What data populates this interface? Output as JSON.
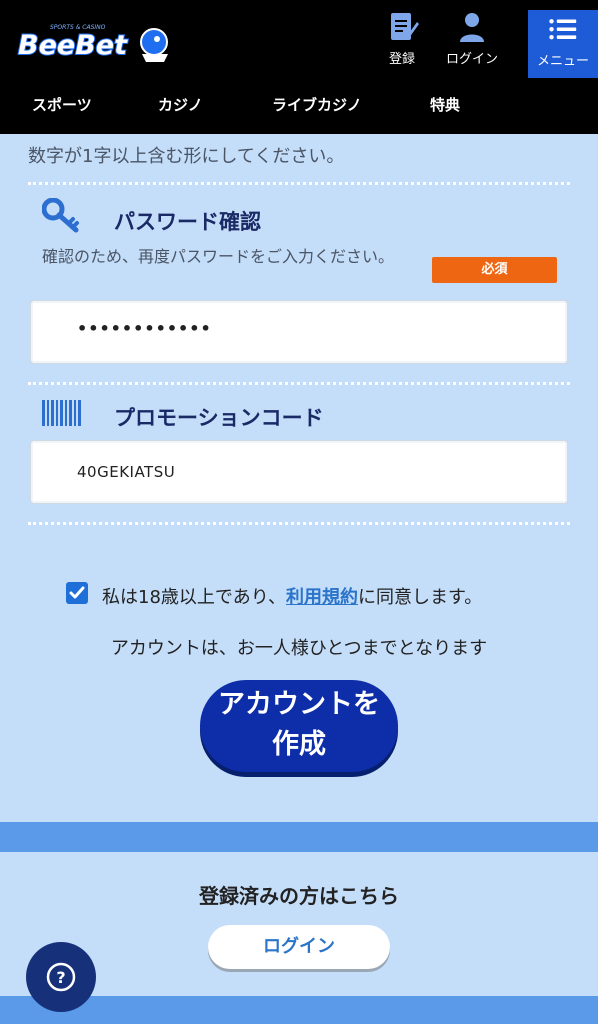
{
  "header": {
    "logo_text": "BeeBet",
    "logo_tagline": "SPORTS & CASINO",
    "register_label": "登録",
    "login_label": "ログイン",
    "menu_label": "メニュー"
  },
  "nav": {
    "items": [
      "スポーツ",
      "カジノ",
      "ライブカジノ",
      "特典"
    ]
  },
  "form": {
    "password_hint_tail": "数字が1字以上含む形にしてください。",
    "password_confirm": {
      "title": "パスワード確認",
      "description": "確認のため、再度パスワードをご入力ください。",
      "required_label": "必須",
      "value": "••••••••••••"
    },
    "promo": {
      "title": "プロモーションコード",
      "value": "40GEKIATSU"
    }
  },
  "consent": {
    "checked": true,
    "prefix": "私は18歳以上であり、",
    "link_text": "利用規約",
    "suffix": "に同意します。"
  },
  "notice": "アカウントは、お一人様ひとつまでとなります",
  "create_button": {
    "line1": "アカウントを",
    "line2": "作成"
  },
  "registered": {
    "title": "登録済みの方はこちら",
    "login_button": "ログイン"
  },
  "colors": {
    "page_bg": "#c4ddf8",
    "header_bg": "#000000",
    "menu_bg": "#1e5bd6",
    "required_badge": "#ee6611",
    "create_button": "#0d2ea8",
    "band": "#5a9ae8",
    "link": "#2a74c9"
  }
}
